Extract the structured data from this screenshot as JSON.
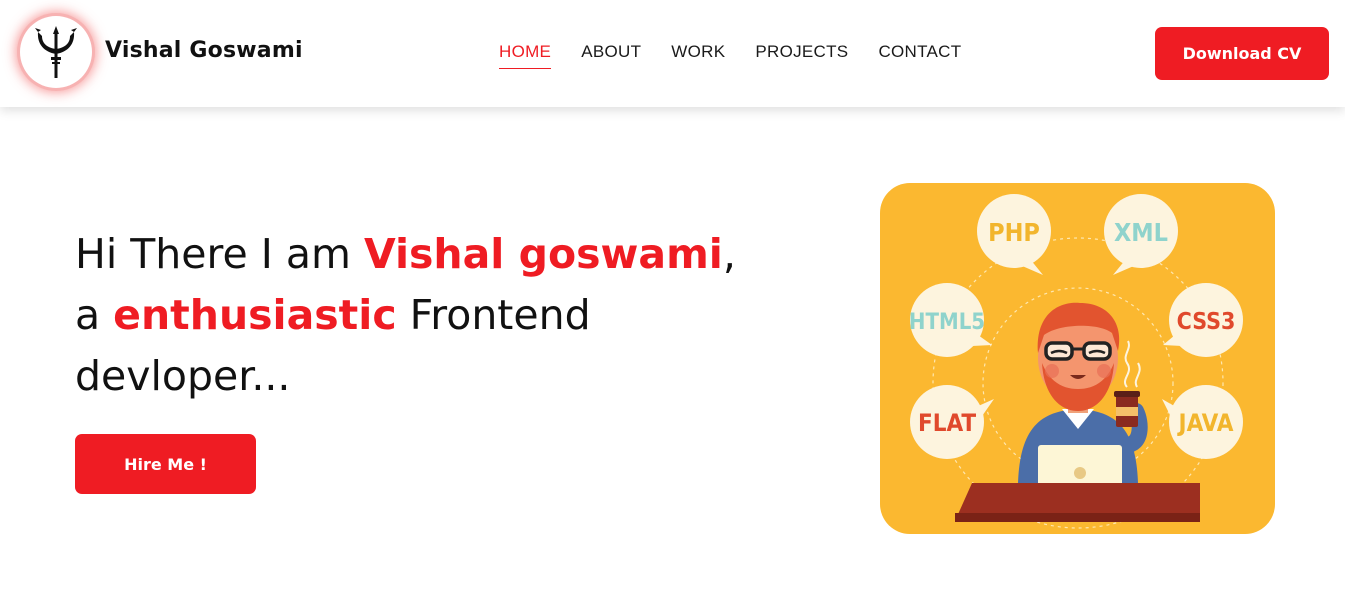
{
  "header": {
    "brand_name": "Vishal Goswami",
    "logo_icon": "trident-icon",
    "nav": [
      {
        "label": "HOME",
        "active": true
      },
      {
        "label": "ABOUT",
        "active": false
      },
      {
        "label": "WORK",
        "active": false
      },
      {
        "label": "PROJECTS",
        "active": false
      },
      {
        "label": "CONTACT",
        "active": false
      }
    ],
    "download_label": "Download CV"
  },
  "hero": {
    "line1_prefix": "Hi There I am ",
    "line1_name": "Vishal goswami",
    "line1_suffix": ",",
    "line2_prefix": "a ",
    "line2_accent": "enthusiastic",
    "line2_suffix": " Frontend",
    "line3": "devloper...",
    "hire_label": "Hire Me !"
  },
  "illustration": {
    "bubbles": [
      "PHP",
      "XML",
      "HTML5",
      "CSS3",
      "FLAT",
      "JAVA"
    ]
  },
  "colors": {
    "accent": "#ef1c23",
    "illustration_bg": "#fbb830"
  }
}
